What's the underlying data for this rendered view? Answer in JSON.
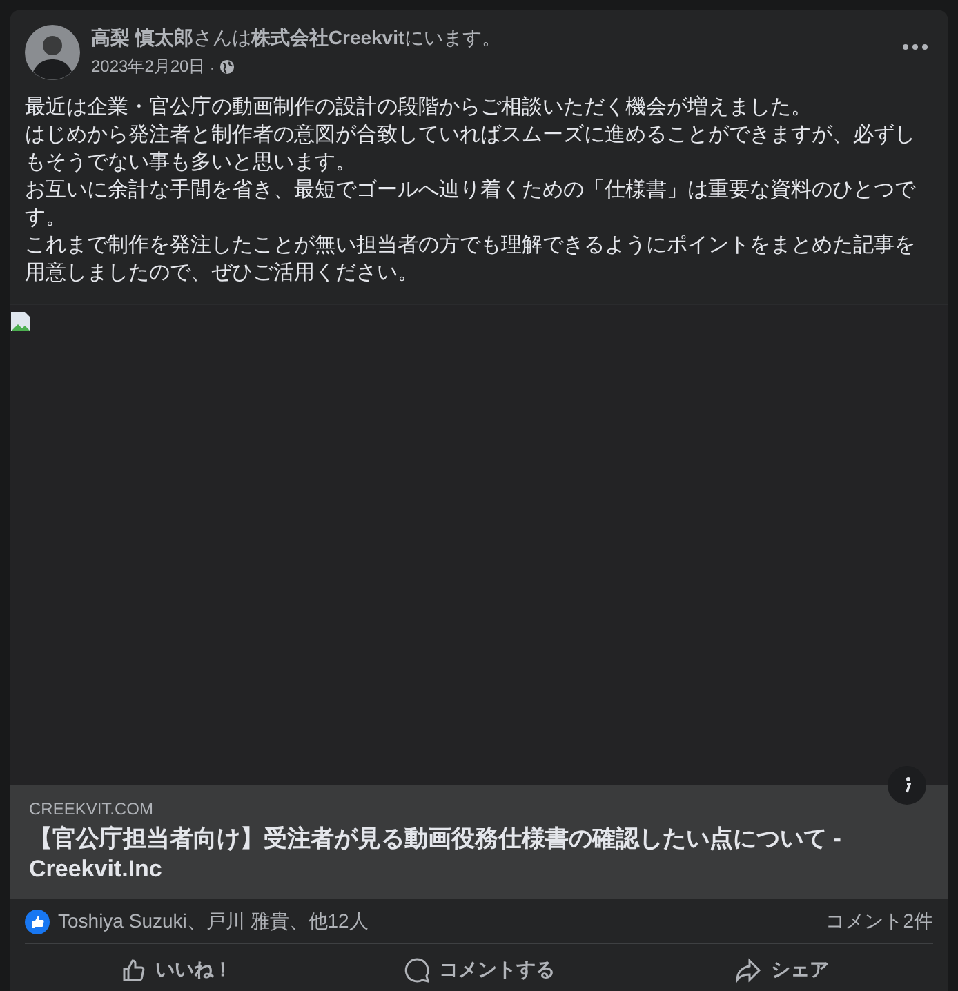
{
  "post": {
    "author_line": "**高梨 慎太郎**さんは**株式会社Creekvit**にいます。",
    "date": "2023年2月20日",
    "separator": "·",
    "paragraphs": [
      "最近は企業・官公庁の動画制作の設計の段階からご相談いただく機会が増えました。",
      "はじめから発注者と制作者の意図が合致していればスムーズに進めることができますが、必ずしもそうでない事も多いと思います。",
      "お互いに余計な手間を省き、最短でゴールへ辿り着くための「仕様書」は重要な資料のひとつです。",
      "これまで制作を発注したことが無い担当者の方でも理解できるようにポイントをまとめた記事を用意しましたので、ぜひご活用ください。"
    ]
  },
  "link_preview": {
    "domain": "CREEKVIT.COM",
    "title": "【官公庁担当者向け】受注者が見る動画役務仕様書の確認したい点について - Creekvit.Inc"
  },
  "reactions": {
    "names": "Toshiya Suzuki、戸川 雅貴、他12人",
    "comments": "コメント2件"
  },
  "actions": [
    {
      "kind": "like",
      "label": "いいね！"
    },
    {
      "kind": "comment",
      "label": "コメントする"
    },
    {
      "kind": "share",
      "label": "シェア"
    }
  ]
}
